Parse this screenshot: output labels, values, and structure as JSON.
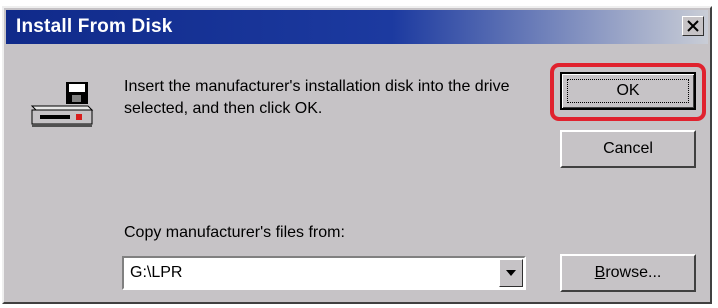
{
  "window": {
    "title": "Install From Disk",
    "close_icon": "close-icon"
  },
  "content": {
    "icon": "floppy-drive-icon",
    "message": "Insert the manufacturer's installation disk into the drive selected, and then click OK.",
    "copy_label": "Copy manufacturer's files from:",
    "path_value": "G:\\LPR"
  },
  "buttons": {
    "ok": "OK",
    "cancel": "Cancel",
    "browse_prefix": "B",
    "browse_rest": "rowse..."
  },
  "colors": {
    "titlebar": "#102a8a",
    "dialog_bg": "#c6c3c6",
    "highlight": "#e0222e"
  }
}
